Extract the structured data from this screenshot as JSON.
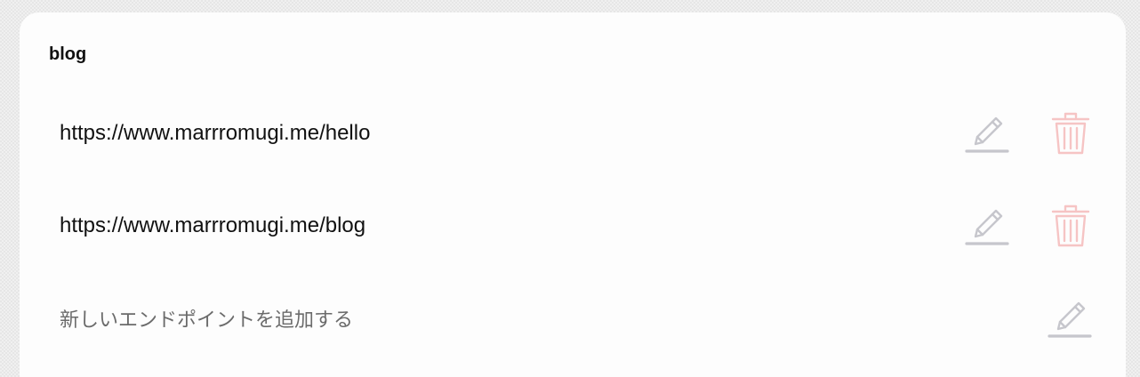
{
  "group": {
    "title": "blog"
  },
  "endpoints": [
    {
      "url": "https://www.marrromugi.me/hello"
    },
    {
      "url": "https://www.marrromugi.me/blog"
    }
  ],
  "new_endpoint": {
    "label": "新しいエンドポイントを追加する"
  },
  "icons": {
    "edit": "pencil-icon",
    "delete": "trash-icon"
  },
  "colors": {
    "edit_icon": "#c6c6cc",
    "delete_icon": "#f6c4c4",
    "card_bg": "#fdfdfd"
  }
}
